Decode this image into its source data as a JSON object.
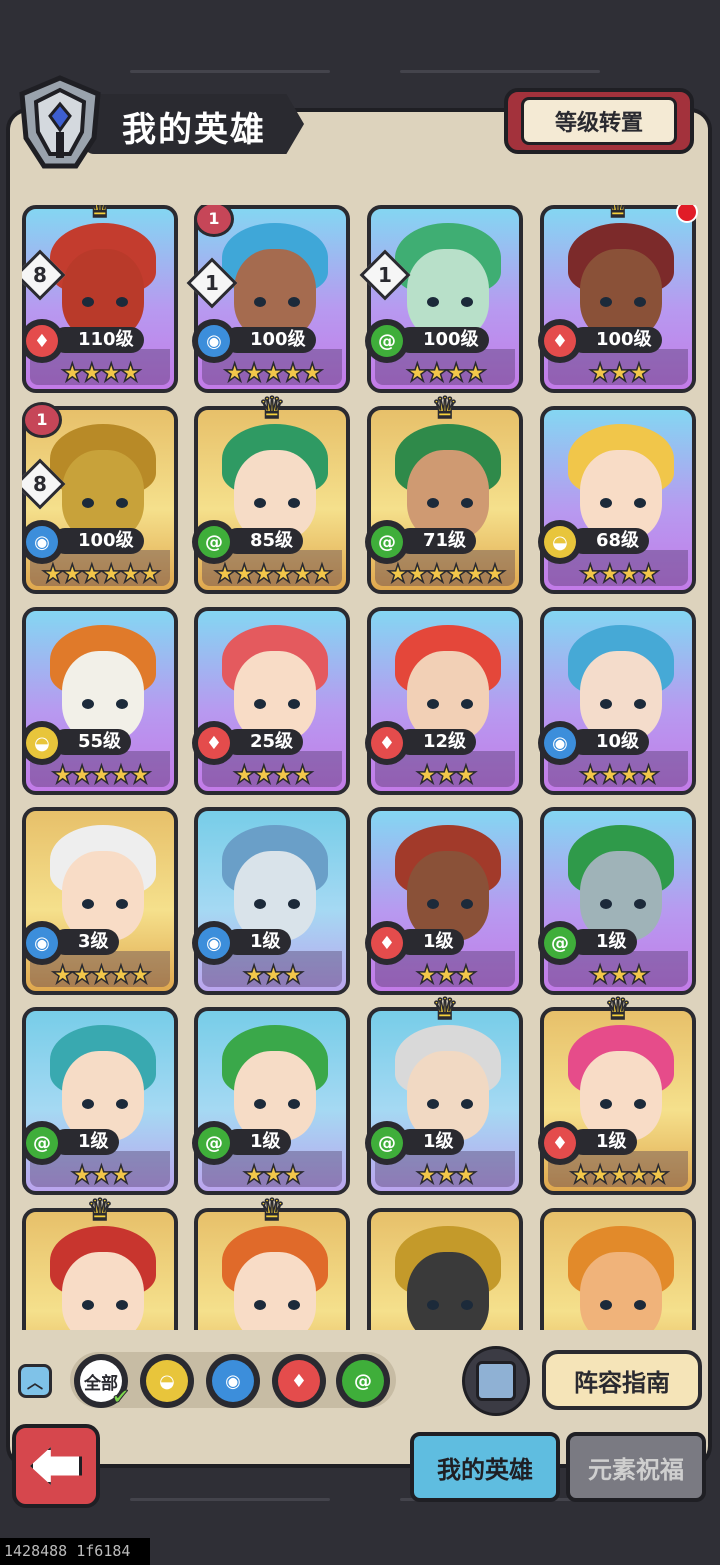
{
  "header": {
    "title": "我的英雄",
    "level_reset_label": "等级转置"
  },
  "heroes": [
    {
      "level": "110级",
      "element": "fire",
      "stars": "★★★★",
      "bg": "bg-purple",
      "crown": true,
      "badge": "8",
      "hair": "#c33c2e",
      "skin": "#b93a2a"
    },
    {
      "level": "100级",
      "element": "water",
      "stars": "★★★★★",
      "bg": "bg-purple",
      "badge": "1",
      "ribbon": "1",
      "hair": "#3fa7d8",
      "skin": "#a56b4f"
    },
    {
      "level": "100级",
      "element": "wind",
      "stars": "★★★★",
      "bg": "bg-purple",
      "badge": "1",
      "hair": "#3fae73",
      "skin": "#b8e0c9"
    },
    {
      "level": "100级",
      "element": "fire",
      "stars": "★★★",
      "bg": "bg-purple",
      "crown": true,
      "dot": true,
      "hair": "#7c2a2a",
      "skin": "#8a5138"
    },
    {
      "level": "100级",
      "element": "water",
      "stars": "★★★★★★",
      "bg": "bg-gold",
      "badge": "8",
      "ribbon": "1",
      "hair": "#b88a27",
      "skin": "#c8a23a"
    },
    {
      "level": "85级",
      "element": "wind",
      "stars": "★★★★★★",
      "bg": "bg-gold",
      "crown": true,
      "hair": "#2f9a63",
      "skin": "#f6dcc6"
    },
    {
      "level": "71级",
      "element": "wind",
      "stars": "★★★★★★",
      "bg": "bg-gold",
      "crown": true,
      "hair": "#2f8a4a",
      "skin": "#cf9a72"
    },
    {
      "level": "68级",
      "element": "earth",
      "stars": "★★★★",
      "bg": "bg-purple",
      "hair": "#f1c64a",
      "skin": "#f8dcc6"
    },
    {
      "level": "55级",
      "element": "earth",
      "stars": "★★★★★",
      "bg": "bg-purple",
      "hair": "#e07a2a",
      "skin": "#f2f0e8"
    },
    {
      "level": "25级",
      "element": "fire",
      "stars": "★★★★",
      "bg": "bg-purple",
      "hair": "#e45a5e",
      "skin": "#f8dcc6"
    },
    {
      "level": "12级",
      "element": "fire",
      "stars": "★★★",
      "bg": "bg-purple",
      "hair": "#e4473a",
      "skin": "#f2d0b6"
    },
    {
      "level": "10级",
      "element": "water",
      "stars": "★★★★",
      "bg": "bg-purple",
      "hair": "#46a9d6",
      "skin": "#f4dccb"
    },
    {
      "level": "3级",
      "element": "water",
      "stars": "★★★★★",
      "bg": "bg-gold",
      "hair": "#eeeeee",
      "skin": "#f8dcc6"
    },
    {
      "level": "1级",
      "element": "water",
      "stars": "★★★",
      "bg": "bg-blue",
      "hair": "#6a9fc8",
      "skin": "#d9e3ea"
    },
    {
      "level": "1级",
      "element": "fire",
      "stars": "★★★",
      "bg": "bg-purple",
      "hair": "#a23a2a",
      "skin": "#8a5138"
    },
    {
      "level": "1级",
      "element": "wind",
      "stars": "★★★",
      "bg": "bg-purple",
      "hair": "#2f9a4a",
      "skin": "#9fb3b8"
    },
    {
      "level": "1级",
      "element": "wind",
      "stars": "★★★",
      "bg": "bg-blue",
      "hair": "#39a9b0",
      "skin": "#f6dcc6"
    },
    {
      "level": "1级",
      "element": "wind",
      "stars": "★★★",
      "bg": "bg-blue",
      "hair": "#3aa84a",
      "skin": "#f6dcc6"
    },
    {
      "level": "1级",
      "element": "wind",
      "stars": "★★★",
      "bg": "bg-blue",
      "crown": true,
      "hair": "#d9d9d9",
      "skin": "#f1d9c3"
    },
    {
      "level": "1级",
      "element": "fire",
      "stars": "★★★★★",
      "bg": "bg-gold",
      "crown": true,
      "hair": "#e64c8a",
      "skin": "#f8dcc6"
    },
    {
      "level": "",
      "element": "",
      "stars": "",
      "bg": "bg-gold",
      "crown": true,
      "hair": "#c8352e",
      "skin": "#f8dcc6"
    },
    {
      "level": "",
      "element": "",
      "stars": "",
      "bg": "bg-gold",
      "crown": true,
      "hair": "#e06a2a",
      "skin": "#f8dcc6"
    },
    {
      "level": "",
      "element": "",
      "stars": "",
      "bg": "bg-gold",
      "hair": "#c49a2a",
      "skin": "#3a3a3a"
    },
    {
      "level": "",
      "element": "",
      "stars": "",
      "bg": "bg-gold",
      "hair": "#e28a2a",
      "skin": "#f0b37a"
    }
  ],
  "filter": {
    "all_label": "全部",
    "elements": [
      "earth",
      "water",
      "fire",
      "wind"
    ]
  },
  "guide_label": "阵容指南",
  "tabs": {
    "my_heroes": "我的英雄",
    "element_blessing": "元素祝福"
  },
  "debug_text": "1428488 1f6184",
  "colors": {
    "fire": "#e44c4c",
    "water": "#3c8edb",
    "wind": "#3fae3a",
    "earth": "#e8c53b"
  }
}
